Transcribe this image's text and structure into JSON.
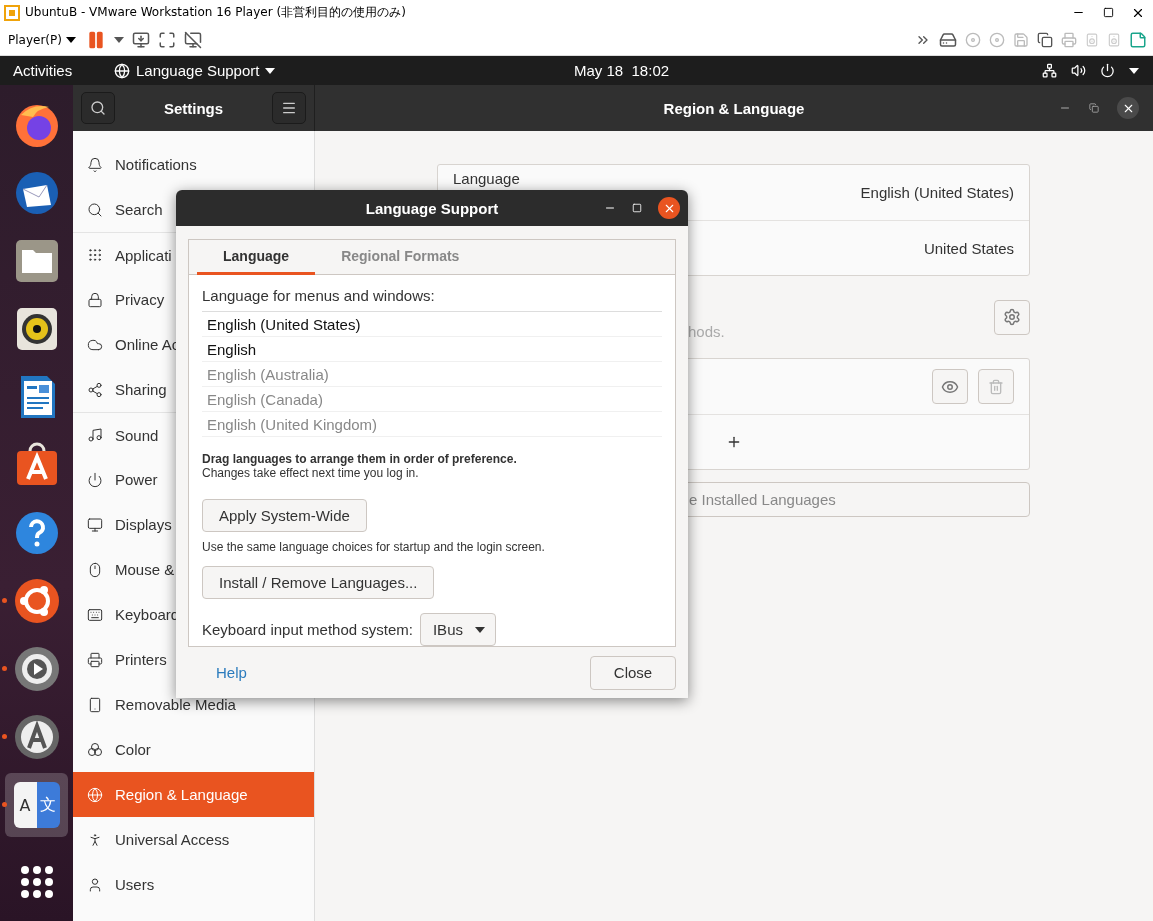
{
  "vm_window": {
    "title": "UbuntuB - VMware Workstation 16 Player (非営利目的の使用のみ)",
    "menu": "Player(P)"
  },
  "topbar": {
    "activities": "Activities",
    "app_menu": "Language Support",
    "clock": "May 18  18:02"
  },
  "dock": [
    {
      "kind": "firefox",
      "running": false,
      "selected": false
    },
    {
      "kind": "thunderbird",
      "running": false,
      "selected": false
    },
    {
      "kind": "files",
      "running": false,
      "selected": false
    },
    {
      "kind": "rhythmbox",
      "running": false,
      "selected": false
    },
    {
      "kind": "writer",
      "running": false,
      "selected": false
    },
    {
      "kind": "software",
      "running": false,
      "selected": false
    },
    {
      "kind": "help",
      "running": false,
      "selected": false
    },
    {
      "kind": "ubuntu",
      "running": true,
      "selected": false
    },
    {
      "kind": "software-properties",
      "running": true,
      "selected": false
    },
    {
      "kind": "updater",
      "running": true,
      "selected": false
    },
    {
      "kind": "language",
      "running": true,
      "selected": true,
      "glyphs": [
        "A",
        "文"
      ]
    }
  ],
  "settings": {
    "title": "Settings",
    "panel_title": "Region & Language",
    "sidebar": [
      {
        "label": "Notifications",
        "kind": "bell",
        "selected": false,
        "separator_above": false
      },
      {
        "label": "Search",
        "kind": "search",
        "selected": false,
        "separator_above": false
      },
      {
        "label": "Applicati",
        "kind": "grid",
        "selected": false,
        "separator_above": true
      },
      {
        "label": "Privacy",
        "kind": "lock",
        "selected": false,
        "separator_above": false
      },
      {
        "label": "Online Ac",
        "kind": "cloud",
        "selected": false,
        "separator_above": false
      },
      {
        "label": "Sharing",
        "kind": "share",
        "selected": false,
        "separator_above": false
      },
      {
        "label": "Sound",
        "kind": "music",
        "selected": false,
        "separator_above": true
      },
      {
        "label": "Power",
        "kind": "power",
        "selected": false,
        "separator_above": false
      },
      {
        "label": "Displays",
        "kind": "monitor",
        "selected": false,
        "separator_above": false
      },
      {
        "label": "Mouse &",
        "kind": "mouse",
        "selected": false,
        "separator_above": false
      },
      {
        "label": "Keyboard",
        "kind": "keyboard",
        "selected": false,
        "separator_above": false
      },
      {
        "label": "Printers",
        "kind": "printer",
        "selected": false,
        "separator_above": false
      },
      {
        "label": "Removable Media",
        "kind": "device",
        "selected": false,
        "separator_above": false
      },
      {
        "label": "Color",
        "kind": "color",
        "selected": false,
        "separator_above": false
      },
      {
        "label": "Region & Language",
        "kind": "globe",
        "selected": true,
        "separator_above": false
      },
      {
        "label": "Universal Access",
        "kind": "access",
        "selected": false,
        "separator_above": false
      },
      {
        "label": "Users",
        "kind": "user",
        "selected": false,
        "separator_above": false
      }
    ],
    "panel": {
      "language_label": "Language",
      "language_value": "English (United States)",
      "formats_value": "United States",
      "input_description": "hods.",
      "manage_button": "e Installed Languages"
    }
  },
  "dialog": {
    "title": "Language Support",
    "tabs": [
      {
        "label": "Language",
        "selected": true
      },
      {
        "label": "Regional Formats",
        "selected": false
      }
    ],
    "list_label": "Language for menus and windows:",
    "languages": [
      {
        "label": "English (United States)",
        "dimmed": false
      },
      {
        "label": "English",
        "dimmed": false
      },
      {
        "label": "English (Australia)",
        "dimmed": true
      },
      {
        "label": "English (Canada)",
        "dimmed": true
      },
      {
        "label": "English (United Kingdom)",
        "dimmed": true
      }
    ],
    "hint_bold": "Drag languages to arrange them in order of preference.",
    "hint": "Changes take effect next time you log in.",
    "apply_button": "Apply System-Wide",
    "apply_note": "Use the same language choices for startup and the login screen.",
    "install_button": "Install / Remove Languages...",
    "keyboard_label": "Keyboard input method system:",
    "keyboard_value": "IBus",
    "help": "Help",
    "close": "Close"
  }
}
